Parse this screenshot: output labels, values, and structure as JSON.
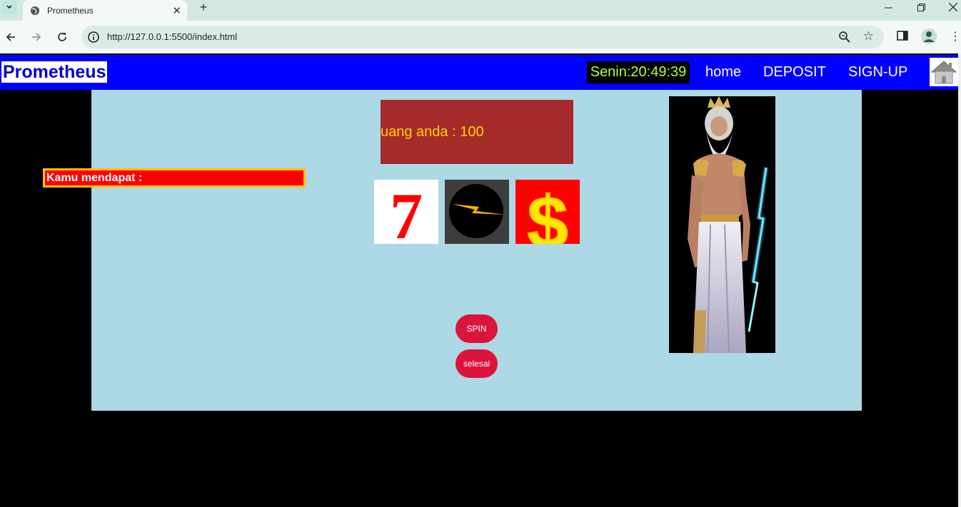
{
  "browser": {
    "tab_title": "Prometheus",
    "url": "http://127.0.0.1:5500/index.html"
  },
  "navbar": {
    "brand": "Prometheus",
    "clock": "Senin:20:49:39",
    "links": [
      "home",
      "DEPOSIT",
      "SIGN-UP"
    ],
    "bg_color": "#0000ff"
  },
  "game": {
    "money_text": "uang anda : 100",
    "result_label": "Kamu mendapat :",
    "reels": [
      "seven",
      "lightning",
      "dollar"
    ],
    "reel_glyphs": [
      "7",
      "$"
    ],
    "spin_label": "SPIN",
    "finish_label": "selesai",
    "panel_color": "#add8e6",
    "money_color": "#a52a2a",
    "button_color": "#dc143c"
  }
}
